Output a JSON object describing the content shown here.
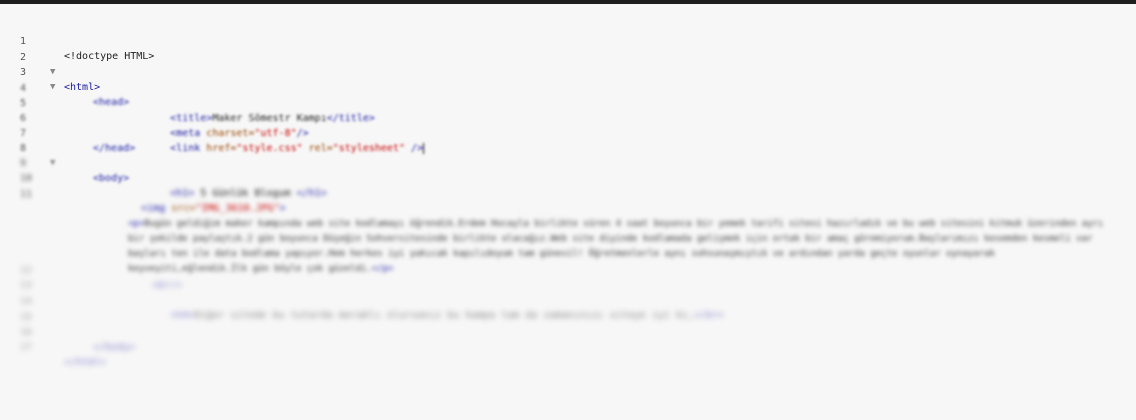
{
  "editor": {
    "lines": [
      {
        "num": "1",
        "fold": "",
        "code": "<!doctype HTML>"
      },
      {
        "num": "2",
        "fold": "▼",
        "code": "<html>"
      },
      {
        "num": "3",
        "fold": "▼",
        "code": "<head>"
      },
      {
        "num": "4",
        "fold": "",
        "code_parts": [
          "<title>",
          "Maker Sömestr Kampı",
          "</title>"
        ]
      },
      {
        "num": "5",
        "fold": "",
        "code_parts": [
          "<meta ",
          "charset=",
          "\"utf-8\"",
          "/>"
        ]
      },
      {
        "num": "6",
        "fold": "",
        "code_parts": [
          "<link ",
          "href=",
          "\"style.css\"",
          " rel=",
          "\"stylesheet\"",
          " />"
        ]
      },
      {
        "num": "7",
        "fold": "",
        "code": "</head>"
      },
      {
        "num": "8",
        "fold": "▼",
        "code": "<body>"
      },
      {
        "num": "9",
        "fold": "",
        "code_parts": [
          "<h1>",
          " 5 Günlük Blogum ",
          "</h1>"
        ]
      },
      {
        "num": "10",
        "fold": "",
        "code_parts": [
          "<img ",
          "src=",
          "\"IMG_3610.JPG\"",
          ">"
        ]
      },
      {
        "num": "11",
        "fold": "",
        "code_parts": [
          "<p>",
          "Bugün geldiğim maker kampında web site kodlamayı öğrendik.Erdem Hocayla birlikte süren 4 saat boyunca bir yemek tarifi sitesi hazırladık ve bu web sitesini kitmuk üzerinden ayrı bir şekilde paylaştık.2 gün boyunca Düşeğin Sohversitesinde birlikte olacağız.Web site diyinde kodlamada gelişmek için ortak bir amaç göremiyorum.Başlarımızı kesemden kesmeli var başları ten ile data bodlama yapıyor.Hem herkes iyi yakıcak kapılıdoyum tam günevil! Öğretmenlerle aynı sohsunaşmıştık ve ardından yarda geçte oyunlar oynayarak keyveyiti,eğlendik.İlk gün böyle çok güzeldi.",
          "</p>"
        ]
      },
      {
        "num": "12",
        "fold": "",
        "code": "<br/>"
      },
      {
        "num": "13",
        "fold": "",
        "code_parts": [
          "<h4>",
          "Diğer sitede bu tutarda meraklı olursanız bu kampa tam da zamanınızı siteye iyi ki,",
          "</br>"
        ]
      },
      {
        "num": "14",
        "fold": "",
        "code": ""
      },
      {
        "num": "15",
        "fold": "",
        "code": ""
      },
      {
        "num": "16",
        "fold": "",
        "code": "</body>"
      },
      {
        "num": "17",
        "fold": "",
        "code": "</html>"
      }
    ]
  }
}
